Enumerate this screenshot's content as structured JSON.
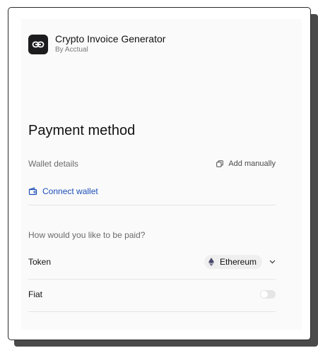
{
  "app": {
    "title": "Crypto Invoice Generator",
    "subtitle": "By Acctual",
    "logo_icon": "link-icon",
    "logo_color": "#1c1c1e"
  },
  "payment": {
    "title": "Payment method",
    "wallet_details_label": "Wallet details",
    "add_manually_label": "Add manually",
    "add_manually_icon": "copy-icon",
    "connect_wallet_label": "Connect wallet",
    "connect_wallet_icon": "wallet-icon",
    "accent_color": "#1d4fb8",
    "question": "How would you like to be paid?"
  },
  "options": {
    "token": {
      "label": "Token",
      "selected_value": "Ethereum",
      "selected_icon": "ethereum-icon"
    },
    "fiat": {
      "label": "Fiat",
      "enabled": false
    }
  }
}
